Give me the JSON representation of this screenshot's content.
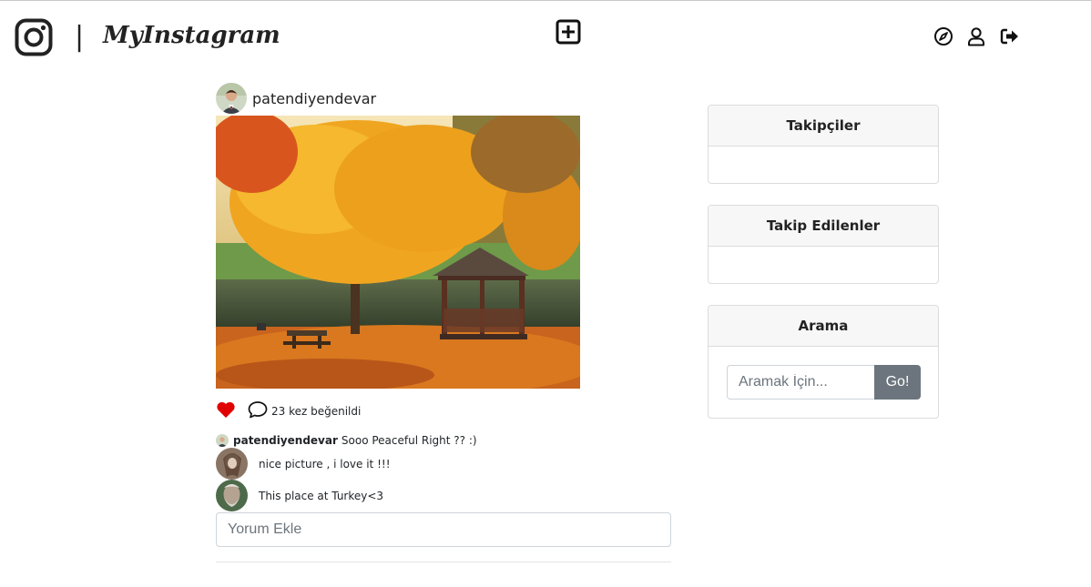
{
  "header": {
    "brand_separator": "|",
    "brand_name": "MyInstagram",
    "icons": [
      "instagram-logo-icon",
      "plus-square-icon",
      "compass-icon",
      "user-icon",
      "sign-out-icon"
    ]
  },
  "post": {
    "username": "patendiyendevar",
    "likes_text": "23 kez beğenildi",
    "liked": true,
    "caption": {
      "username": "patendiyendevar",
      "text": "Sooo Peaceful Right ?? :)"
    },
    "comments": [
      {
        "text": "nice picture , i love it !!!"
      },
      {
        "text": "This place at Turkey<3"
      }
    ],
    "comment_placeholder": "Yorum Ekle"
  },
  "sidebar": {
    "followers_title": "Takipçiler",
    "following_title": "Takip Edilenler",
    "search_title": "Arama",
    "search_placeholder": "Aramak İçin...",
    "search_button": "Go!"
  },
  "colors": {
    "like": "#e00000",
    "button_secondary": "#6c757d",
    "card_header": "#f7f7f7"
  }
}
